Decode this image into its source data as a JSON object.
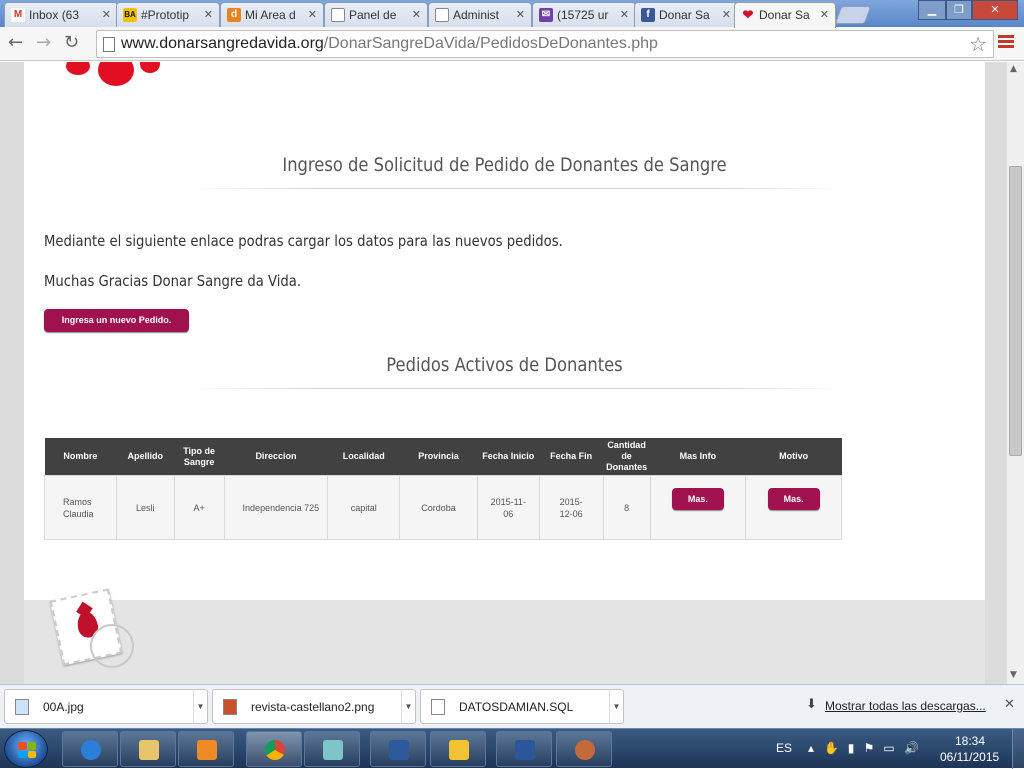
{
  "browser": {
    "tabs": [
      {
        "label": "Inbox (63",
        "fav_color": "#d93025",
        "fav_text": "M"
      },
      {
        "label": "#Prototip",
        "fav_color": "#1a1a1a",
        "fav_text": "BA"
      },
      {
        "label": "Mi Area d",
        "fav_color": "#e8831f",
        "fav_text": "d"
      },
      {
        "label": "Panel de",
        "fav_color": "#ffffff",
        "fav_text": ""
      },
      {
        "label": "Administ",
        "fav_color": "#ffffff",
        "fav_text": ""
      },
      {
        "label": "(15725 ur",
        "fav_color": "#6e40a8",
        "fav_text": "✉"
      },
      {
        "label": "Donar Sa",
        "fav_color": "#3b5998",
        "fav_text": "f"
      },
      {
        "label": "Donar Sa",
        "fav_color": "#ffffff",
        "fav_text": "❤"
      }
    ],
    "url_domain": "www.donarsangredavida.org",
    "url_path": "/DonarSangreDaVida/PedidosDeDonantes.php"
  },
  "page": {
    "title": "Ingreso de Solicitud de Pedido de Donantes de Sangre",
    "intro": "Mediante el siguiente enlace podras cargar los datos para las nuevos pedidos.",
    "thanks": "Muchas Gracias Donar Sangre da Vida.",
    "new_order_button": "Ingresa un nuevo Pedido.",
    "active_title": "Pedidos Activos de Donantes"
  },
  "table": {
    "headers": [
      "Nombre",
      "Apellido",
      "Tipo de Sangre",
      "Direccion",
      "Localidad",
      "Provincia",
      "Fecha Inicio",
      "Fecha Fin",
      "Cantidad de Donantes",
      "Mas Info",
      "Motivo"
    ],
    "rows": [
      {
        "nombre": "Ramos Claudia",
        "apellido": "Lesli",
        "tipo": "A+",
        "direccion": "Independencia 725",
        "localidad": "capital",
        "provincia": "Cordoba",
        "inicio": "2015-11-06",
        "fin": "2015-12-06",
        "cantidad": "8",
        "mas_info": "Mas.",
        "motivo": "Mas."
      }
    ]
  },
  "downloads": {
    "items": [
      "00A.jpg",
      "revista-castellano2.png",
      "DATOSDAMIAN.SQL"
    ],
    "show_all": "Mostrar todas las descargas..."
  },
  "taskbar": {
    "lang": "ES",
    "time": "18:34",
    "date": "06/11/2015"
  }
}
